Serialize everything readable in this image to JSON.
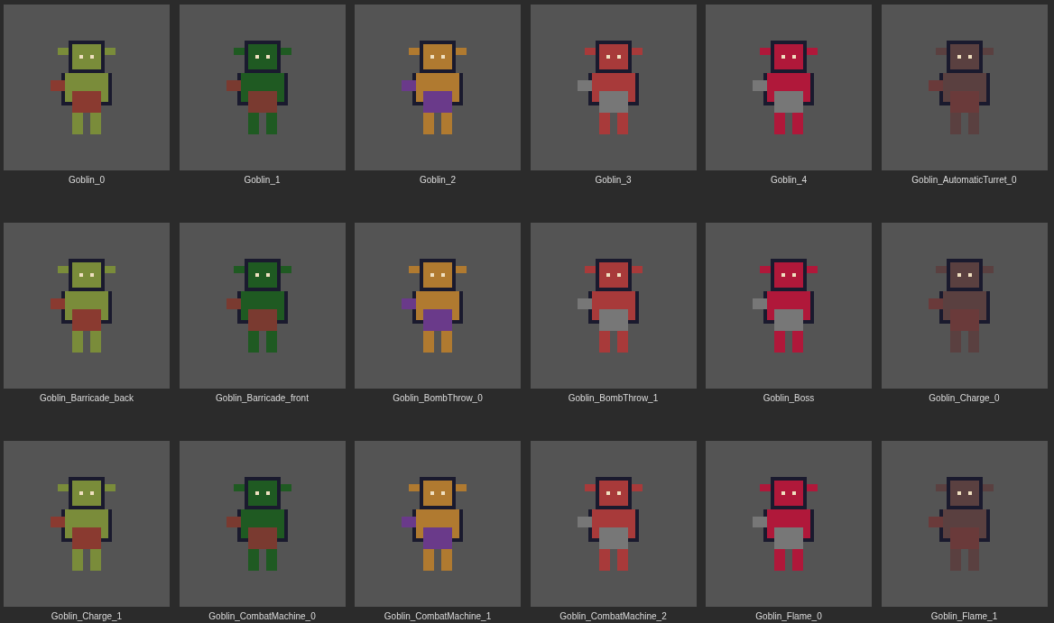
{
  "assets": [
    {
      "name": "Goblin_0"
    },
    {
      "name": "Goblin_1"
    },
    {
      "name": "Goblin_2"
    },
    {
      "name": "Goblin_3"
    },
    {
      "name": "Goblin_4"
    },
    {
      "name": "Goblin_AutomaticTurret_0"
    },
    {
      "name": "Goblin_Barricade_back"
    },
    {
      "name": "Goblin_Barricade_front"
    },
    {
      "name": "Goblin_BombThrow_0"
    },
    {
      "name": "Goblin_BombThrow_1"
    },
    {
      "name": "Goblin_Boss"
    },
    {
      "name": "Goblin_Charge_0"
    },
    {
      "name": "Goblin_Charge_1"
    },
    {
      "name": "Goblin_CombatMachine_0"
    },
    {
      "name": "Goblin_CombatMachine_1"
    },
    {
      "name": "Goblin_CombatMachine_2"
    },
    {
      "name": "Goblin_Flame_0"
    },
    {
      "name": "Goblin_Flame_1"
    }
  ]
}
